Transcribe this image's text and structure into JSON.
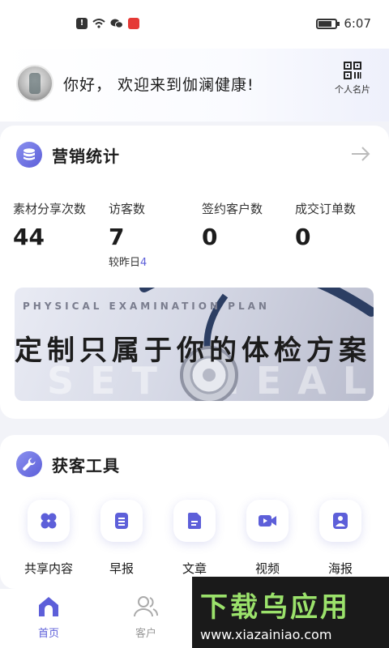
{
  "status_bar": {
    "time": "6:07",
    "icons": [
      "alert-icon",
      "wifi-icon",
      "wechat-icon",
      "app-badge-icon",
      "battery-icon"
    ]
  },
  "header": {
    "greeting": "你好， 欢迎来到伽澜健康!",
    "qr_label": "个人名片"
  },
  "marketing": {
    "title": "营销统计",
    "stats": [
      {
        "label": "素材分享次数",
        "value": "44"
      },
      {
        "label": "访客数",
        "value": "7",
        "sub_label": "较昨日",
        "sub_value": "4"
      },
      {
        "label": "签约客户数",
        "value": "0"
      },
      {
        "label": "成交订单数",
        "value": "0"
      }
    ],
    "banner": {
      "english": "PHYSICAL EXAMINATION PLAN",
      "chinese": "定制只属于你的体检方案",
      "background_text": "SET MEAL"
    }
  },
  "tools": {
    "title": "获客工具",
    "items": [
      {
        "label": "共享内容",
        "icon": "clover-icon"
      },
      {
        "label": "早报",
        "icon": "document-icon"
      },
      {
        "label": "文章",
        "icon": "article-icon"
      },
      {
        "label": "视频",
        "icon": "video-icon"
      },
      {
        "label": "海报",
        "icon": "image-icon"
      }
    ]
  },
  "tabbar": {
    "items": [
      {
        "label": "首页",
        "active": true
      },
      {
        "label": "客户",
        "active": false
      }
    ]
  },
  "watermark": {
    "title": "下载乌应用",
    "url": "www.xiazainiao.com"
  },
  "colors": {
    "accent": "#5d5fd9",
    "background": "#f2f3f8",
    "card": "#ffffff"
  }
}
